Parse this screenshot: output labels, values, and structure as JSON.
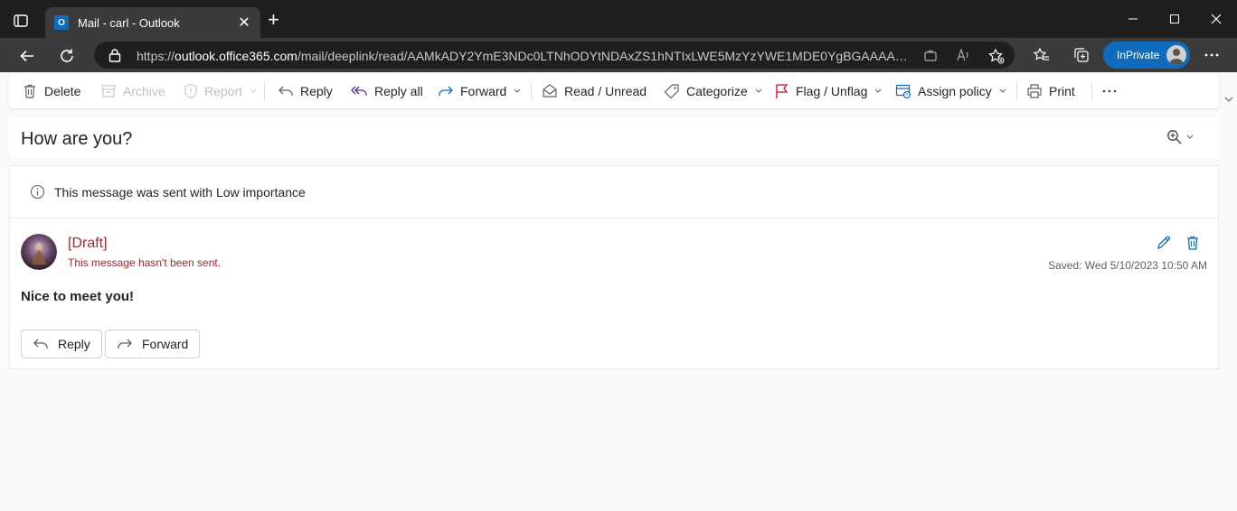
{
  "browser": {
    "tab": {
      "title": "Mail - carl - Outlook",
      "favicon": "O"
    },
    "url": {
      "scheme": "https://",
      "host": "outlook.office365.com",
      "path": "/mail/deeplink/read/AAMkADY2YmE3NDc0LTNhODYtNDAxZS1hNTIxLWE5MzYzYWE1MDE0YgBGAAAAAAD..."
    },
    "inprivate_label": "InPrivate",
    "colors": {
      "accent": "#0f6cbd",
      "chrome_dark": "#1f1f1f",
      "chrome_mid": "#3b3b3b"
    }
  },
  "commands": [
    {
      "label": "Delete",
      "icon": "trash-icon",
      "enabled": true
    },
    {
      "label": "Archive",
      "icon": "archive-icon",
      "enabled": false
    },
    {
      "label": "Report",
      "icon": "shield-icon",
      "enabled": false
    },
    {
      "label": "Reply",
      "icon": "reply-icon",
      "enabled": true
    },
    {
      "label": "Reply all",
      "icon": "reply-all-icon",
      "enabled": true
    },
    {
      "label": "Forward",
      "icon": "forward-icon",
      "enabled": true
    },
    {
      "label": "Read / Unread",
      "icon": "envelope-open-icon",
      "enabled": true
    },
    {
      "label": "Categorize",
      "icon": "tag-icon",
      "enabled": true
    },
    {
      "label": "Flag / Unflag",
      "icon": "flag-icon",
      "enabled": true
    },
    {
      "label": "Assign policy",
      "icon": "policy-icon",
      "enabled": true
    },
    {
      "label": "Print",
      "icon": "print-icon",
      "enabled": true
    },
    {
      "label": "...",
      "icon": "more-icon",
      "enabled": true
    }
  ],
  "message": {
    "subject": "How are you?",
    "info": "This message was sent with Low importance",
    "draft_title": "[Draft]",
    "draft_note": "This message hasn't been sent.",
    "saved": "Saved: Wed 5/10/2023 10:50 AM",
    "body": "Nice to meet you!",
    "reply_label": "Reply",
    "forward_label": "Forward",
    "colors": {
      "draft": "#a4262c",
      "icon_blue": "#0f6cbd"
    }
  }
}
